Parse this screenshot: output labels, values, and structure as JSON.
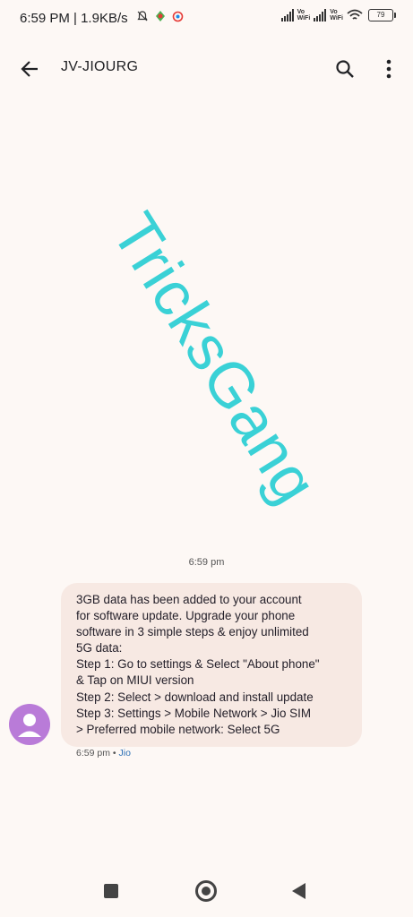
{
  "status_bar": {
    "time": "6:59 PM | 1.9KB/s",
    "volte1": "Vo",
    "wifi1": "WiFi",
    "volte2": "Vo",
    "wifi2": "WiFi",
    "battery": "79"
  },
  "header": {
    "title": "JV-JIOURG"
  },
  "icons": {
    "back": "arrow-back-icon",
    "search": "search-icon",
    "more": "more-vert-icon",
    "avatar": "person-icon"
  },
  "colors": {
    "background": "#fdf8f5",
    "bubble": "#f7e9e3",
    "avatar": "#b97bd8",
    "watermark": "#3ad1d6",
    "sim_label": "#2a6fb5"
  },
  "conversation": {
    "watermark": "TricksGang",
    "timestamp_divider": "6:59 pm",
    "message": {
      "lines": [
        "3GB data has been added to your account",
        "for software update. Upgrade your phone",
        "software in 3 simple steps & enjoy unlimited",
        "5G data:",
        "Step 1: Go to settings & Select \"About phone\"",
        "& Tap on MIUI version",
        "Step 2: Select > download and install update",
        "Step 3: Settings > Mobile Network > Jio SIM",
        "> Preferred mobile network: Select 5G"
      ],
      "time": "6:59 pm",
      "separator": "•",
      "sim": "Jio"
    }
  }
}
